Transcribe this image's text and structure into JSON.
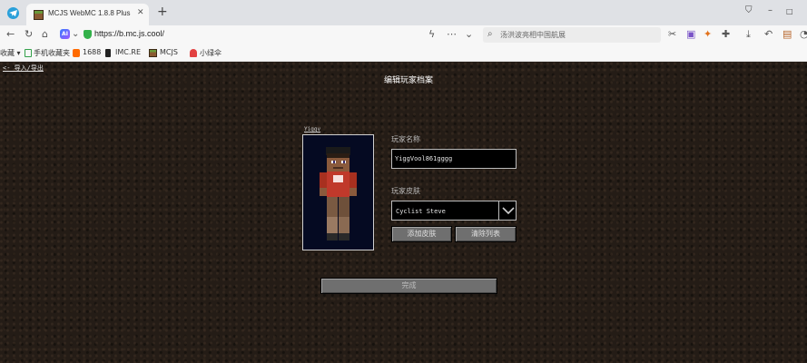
{
  "browser": {
    "tab_title": "MCJS WebMC 1.8.8 Plus",
    "tab_close": "✕",
    "new_tab": "+",
    "url": "https://b.mc.js.cool/",
    "search_placeholder": "汤洪波亮相中国航展",
    "ai_label": "AI",
    "window_controls": [
      "–",
      "□",
      "✕"
    ]
  },
  "bookmarks": [
    {
      "label": "手机收藏夹",
      "icon": "phone-icon"
    },
    {
      "label": "1688",
      "icon": "1688-icon"
    },
    {
      "label": "IMC.RE",
      "icon": "imc-icon"
    },
    {
      "label": "MCJS",
      "icon": "grass-block-icon"
    },
    {
      "label": "小绿伞",
      "icon": "umbrella-icon"
    }
  ],
  "bookmarks_prefix": "收藏",
  "game": {
    "back_link": "<- 导入/导出",
    "title": "编辑玩家档案",
    "preview_label": "Yiggv",
    "name_label": "玩家名称",
    "name_value": "YiggVool861gggg",
    "skin_label": "玩家皮肤",
    "skin_value": "Cyclist Steve",
    "add_skin": "添加皮肤",
    "clear_list": "清除列表",
    "done": "完成"
  },
  "colors": {
    "panel_bg": "#241c16",
    "button": "#6f6f6f",
    "preview_bg": "#050a22"
  }
}
